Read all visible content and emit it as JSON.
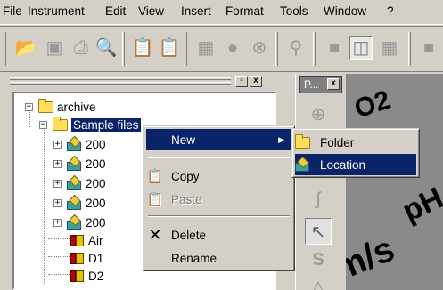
{
  "menubar": {
    "items": [
      "File",
      "Instrument",
      "Edit",
      "View",
      "Insert",
      "Format",
      "Tools",
      "Window",
      "?"
    ]
  },
  "toolbar": {
    "buttons": [
      "open-icon",
      "save-icon",
      "print-icon",
      "print-preview-icon",
      "copy-icon",
      "paste-icon",
      "calculator-icon",
      "record-icon",
      "stop-icon",
      "find-icon",
      "view-single-icon",
      "view-split-icon",
      "view-grid-icon"
    ]
  },
  "tree_pane": {
    "close_glyph": "x",
    "nodes": [
      {
        "label": "archive",
        "kind": "folder",
        "expander": "−"
      },
      {
        "label": "Sample files",
        "kind": "folder",
        "expander": "−",
        "selected": true
      },
      {
        "label": "200",
        "kind": "location",
        "expander": "+"
      },
      {
        "label": "200",
        "kind": "location",
        "expander": "+"
      },
      {
        "label": "200",
        "kind": "location",
        "expander": "+"
      },
      {
        "label": "200",
        "kind": "location",
        "expander": "+"
      },
      {
        "label": "200",
        "kind": "location",
        "expander": "+"
      },
      {
        "label": "Air",
        "kind": "record",
        "expander": ""
      },
      {
        "label": "D1",
        "kind": "record",
        "expander": ""
      },
      {
        "label": "D2",
        "kind": "record",
        "expander": ""
      }
    ]
  },
  "palette": {
    "title": "P...",
    "close_glyph": "x"
  },
  "canvas": {
    "texts": [
      "O2",
      "pH",
      "m/s"
    ]
  },
  "context_menu": {
    "items": [
      {
        "label": "New",
        "icon": "",
        "submenu": true,
        "highlighted": true
      },
      {
        "label": "Copy",
        "icon": "copy-icon"
      },
      {
        "label": "Paste",
        "icon": "paste-icon",
        "disabled": true
      },
      {
        "label": "Delete",
        "icon": "delete-icon"
      },
      {
        "label": "Rename",
        "icon": ""
      }
    ]
  },
  "submenu": {
    "items": [
      {
        "label": "Folder",
        "icon": "folder-icon"
      },
      {
        "label": "Location",
        "icon": "location-icon",
        "highlighted": true
      }
    ]
  },
  "colors": {
    "face": "#d4d0c8",
    "highlight": "#0a246a",
    "canvas": "#8a8a8a"
  }
}
